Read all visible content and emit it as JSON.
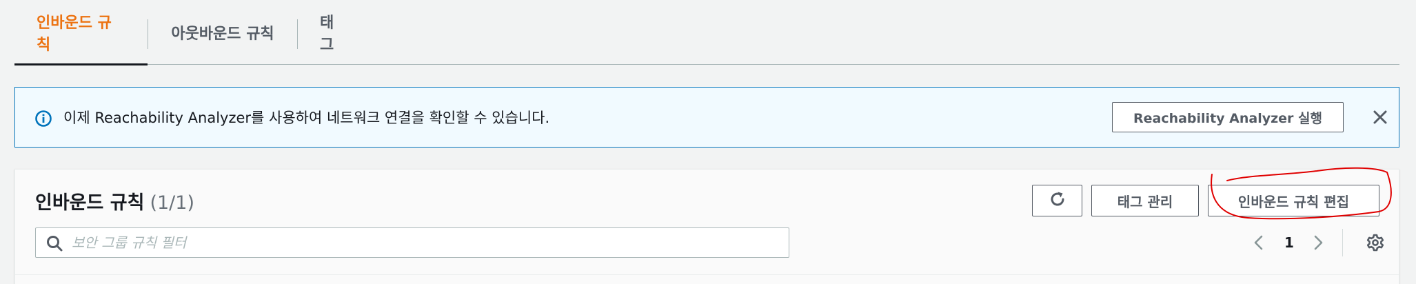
{
  "tabs": [
    {
      "label": "인바운드 규칙",
      "active": true
    },
    {
      "label": "아웃바운드 규칙",
      "active": false
    },
    {
      "label": "태그",
      "active": false
    }
  ],
  "flash": {
    "icon": "info-icon",
    "message": "이제 Reachability Analyzer를 사용하여 네트워크 연결을 확인할 수 있습니다.",
    "button_label": "Reachability Analyzer 실행",
    "close_icon": "close-icon"
  },
  "panel": {
    "title": "인바운드 규칙",
    "count": "(1/1)",
    "refresh_icon": "refresh-icon",
    "manage_tags_label": "태그 관리",
    "edit_rules_label": "인바운드 규칙 편집",
    "search": {
      "placeholder": "보안 그룹 규칙 필터",
      "value": ""
    },
    "pagination": {
      "current_page": "1"
    },
    "settings_icon": "gear-icon"
  },
  "colors": {
    "accent": "#ec7211",
    "info_border": "#0073bb",
    "info_bg": "#f1faff",
    "annotation": "#e00000"
  }
}
